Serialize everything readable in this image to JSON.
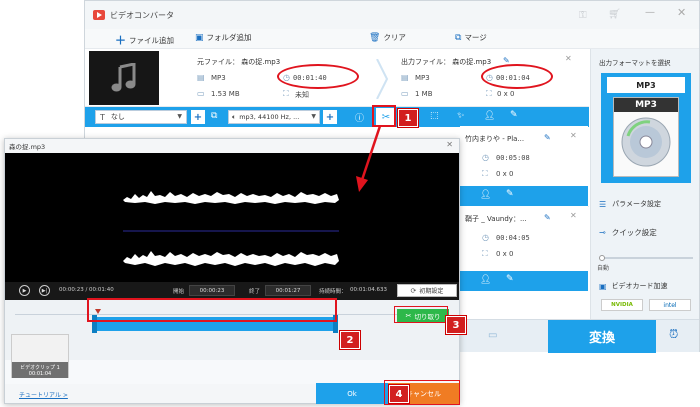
{
  "main_window": {
    "title": "ビデオコンバータ",
    "toolbar": {
      "add_file": "ファイル追加",
      "add_folder": "フォルダ追加",
      "clear": "クリア",
      "merge": "マージ"
    },
    "source": {
      "label": "元ファイル： 森の捉.mp3",
      "format": "MP3",
      "duration": "00:01:40",
      "size": "1.53 MB",
      "resolution": "未知"
    },
    "output": {
      "label": "出力ファイル： 森の捉.mp3",
      "format": "MP3",
      "duration": "00:01:04",
      "size": "1 MB",
      "resolution": "0 x 0"
    },
    "edit_bar": {
      "subtitle": "なし",
      "audio": "mp3, 44100 Hz, ..."
    },
    "item2": {
      "name": "竹内まりや - Pla...",
      "duration": "00:05:08",
      "resolution": "0 x 0"
    },
    "item3": {
      "name": "鞘子 _ Vaundy：...",
      "duration": "00:04:05",
      "resolution": "0 x 0"
    },
    "right_panel": {
      "format_heading": "出力フォーマットを選択",
      "format": "MP3",
      "param_settings": "パラメータ設定",
      "quick_settings": "クイック設定",
      "auto_label": "自動",
      "gpu_accel": "ビデオカード加速",
      "nvidia": "NVIDIA",
      "intel": "intel",
      "convert": "変換"
    }
  },
  "editor": {
    "title": "森の捉.mp3",
    "time_position": "00:00:23 / 00:01:40",
    "start_label": "開始",
    "start_value": "00:00:23",
    "end_label": "終了",
    "end_value": "00:01:27",
    "duration_label": "持続時間：",
    "duration_value": "00:01:04.633",
    "reset": "初期設定",
    "cut": "切り取り",
    "clip_label": "ビデオクリップ 1",
    "clip_time": "00:01:04",
    "tutorial": "チュートリアル >",
    "ok": "Ok",
    "cancel": "キャンセル"
  },
  "annotations": [
    "1",
    "2",
    "3",
    "4"
  ],
  "colors": {
    "accent": "#1ea1ea",
    "cut_green": "#2db84a",
    "cancel_orange": "#f07c23",
    "annotation_red": "#d21f1f"
  }
}
